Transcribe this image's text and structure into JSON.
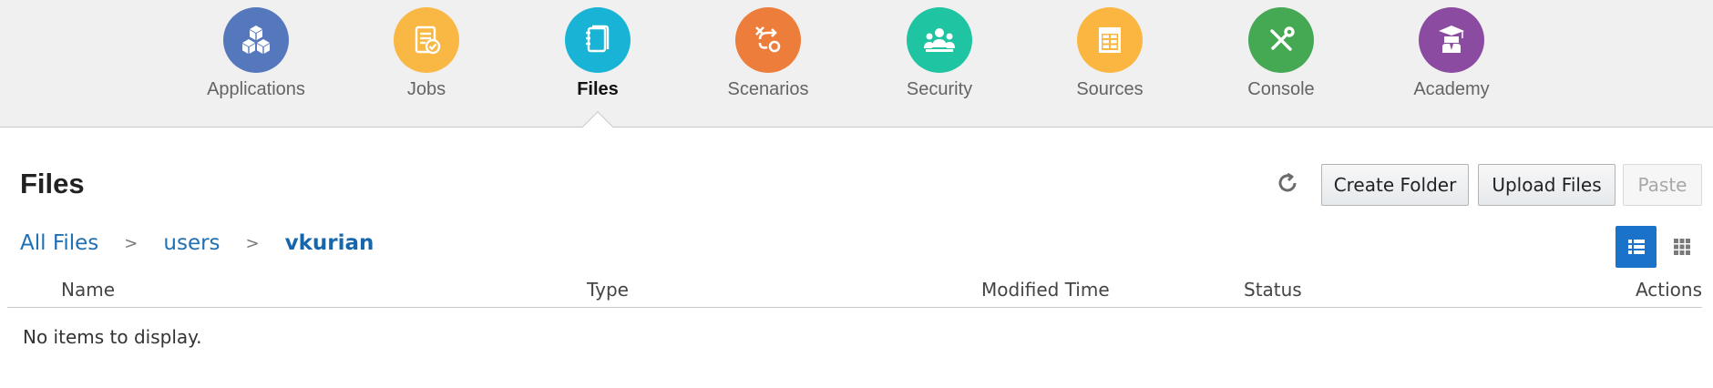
{
  "nav": {
    "items": [
      {
        "label": "Applications",
        "icon": "cubes-icon",
        "color": "#5578bd",
        "active": false
      },
      {
        "label": "Jobs",
        "icon": "clipboard-check-icon",
        "color": "#f9b743",
        "active": false
      },
      {
        "label": "Files",
        "icon": "files-icon",
        "color": "#19b4d5",
        "active": true
      },
      {
        "label": "Scenarios",
        "icon": "scenario-path-icon",
        "color": "#ed7d3b",
        "active": false
      },
      {
        "label": "Security",
        "icon": "users-group-icon",
        "color": "#1fc4a2",
        "active": false
      },
      {
        "label": "Sources",
        "icon": "table-sheet-icon",
        "color": "#fab640",
        "active": false
      },
      {
        "label": "Console",
        "icon": "tools-icon",
        "color": "#45a853",
        "active": false
      },
      {
        "label": "Academy",
        "icon": "graduate-icon",
        "color": "#8b4ba1",
        "active": false
      }
    ]
  },
  "page": {
    "title": "Files"
  },
  "toolbar": {
    "refresh_icon": "refresh-icon",
    "create_folder_label": "Create Folder",
    "upload_files_label": "Upload Files",
    "paste_label": "Paste"
  },
  "breadcrumb": {
    "items": [
      "All Files",
      "users"
    ],
    "separator": ">",
    "current": "vkurian"
  },
  "view_toggle": {
    "list_icon": "list-view-icon",
    "grid_icon": "grid-view-icon",
    "active": "list",
    "active_color": "#1a73c8"
  },
  "table": {
    "columns": [
      "Name",
      "Type",
      "Modified Time",
      "Status",
      "Actions"
    ],
    "empty_message": "No items to display."
  }
}
